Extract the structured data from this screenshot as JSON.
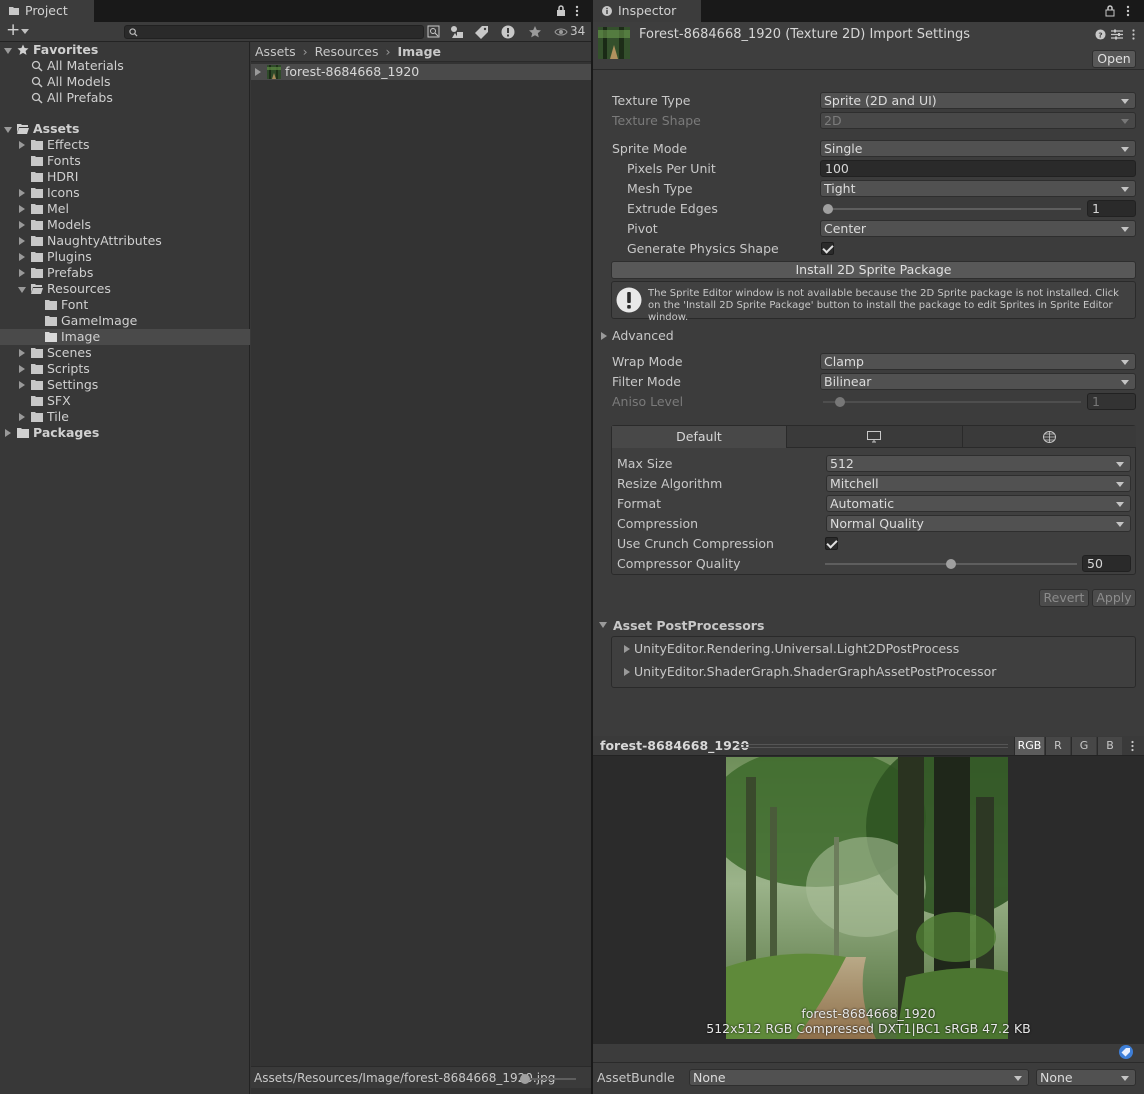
{
  "project_tab": {
    "title": "Project"
  },
  "inspector_tab": {
    "title": "Inspector"
  },
  "project_toolbar": {
    "add_label": "+",
    "search_placeholder": "",
    "hidden_count": "34"
  },
  "tree": {
    "favorites": {
      "label": "Favorites",
      "items": [
        "All Materials",
        "All Models",
        "All Prefabs"
      ]
    },
    "assets": {
      "label": "Assets",
      "folders": [
        {
          "label": "Effects"
        },
        {
          "label": "Fonts"
        },
        {
          "label": "HDRI"
        },
        {
          "label": "Icons"
        },
        {
          "label": "Mel"
        },
        {
          "label": "Models"
        },
        {
          "label": "NaughtyAttributes"
        },
        {
          "label": "Plugins"
        },
        {
          "label": "Prefabs"
        },
        {
          "label": "Resources"
        },
        {
          "label": "Font"
        },
        {
          "label": "GameImage"
        },
        {
          "label": "Image"
        },
        {
          "label": "Scenes"
        },
        {
          "label": "Scripts"
        },
        {
          "label": "Settings"
        },
        {
          "label": "SFX"
        },
        {
          "label": "Tile"
        }
      ]
    },
    "packages": {
      "label": "Packages"
    }
  },
  "breadcrumb": [
    "Assets",
    "Resources",
    "Image"
  ],
  "file_list": [
    {
      "name": "forest-8684668_1920"
    }
  ],
  "project_footer": {
    "path": "Assets/Resources/Image/forest-8684668_1920.jpg"
  },
  "inspector": {
    "title": "Forest-8684668_1920 (Texture 2D) Import Settings",
    "open_label": "Open",
    "texture_type": {
      "label": "Texture Type",
      "value": "Sprite (2D and UI)"
    },
    "texture_shape": {
      "label": "Texture Shape",
      "value": "2D"
    },
    "sprite_mode": {
      "label": "Sprite Mode",
      "value": "Single"
    },
    "pixels_per_unit": {
      "label": "Pixels Per Unit",
      "value": "100"
    },
    "mesh_type": {
      "label": "Mesh Type",
      "value": "Tight"
    },
    "extrude_edges": {
      "label": "Extrude Edges",
      "value": "1",
      "fraction": 0.0
    },
    "pivot": {
      "label": "Pivot",
      "value": "Center"
    },
    "generate_physics": {
      "label": "Generate Physics Shape",
      "checked": true
    },
    "install_button": "Install 2D Sprite Package",
    "help_text": "The Sprite Editor window is not available because the 2D Sprite package is not installed. Click on the 'Install 2D Sprite Package' button to install the package to edit Sprites in Sprite Editor window.",
    "advanced": {
      "label": "Advanced"
    },
    "wrap_mode": {
      "label": "Wrap Mode",
      "value": "Clamp"
    },
    "filter_mode": {
      "label": "Filter Mode",
      "value": "Bilinear"
    },
    "aniso_level": {
      "label": "Aniso Level",
      "value": "1",
      "fraction": 0.0
    },
    "platform_tabs": {
      "default_label": "Default"
    },
    "max_size": {
      "label": "Max Size",
      "value": "512"
    },
    "resize_algorithm": {
      "label": "Resize Algorithm",
      "value": "Mitchell"
    },
    "format": {
      "label": "Format",
      "value": "Automatic"
    },
    "compression": {
      "label": "Compression",
      "value": "Normal Quality"
    },
    "use_crunch": {
      "label": "Use Crunch Compression",
      "checked": true
    },
    "compressor_quality": {
      "label": "Compressor Quality",
      "value": "50",
      "fraction": 0.5
    },
    "revert_label": "Revert",
    "apply_label": "Apply",
    "postprocessors": {
      "label": "Asset PostProcessors",
      "items": [
        "UnityEditor.Rendering.Universal.Light2DPostProcess",
        "UnityEditor.ShaderGraph.ShaderGraphAssetPostProcessor"
      ]
    }
  },
  "preview": {
    "title": "forest-8684668_1920",
    "channels": [
      "RGB",
      "R",
      "G",
      "B"
    ],
    "caption_name": "forest-8684668_1920",
    "caption_info": "512x512  RGB Compressed DXT1|BC1 sRGB  47.2 KB"
  },
  "asset_bundle": {
    "label": "AssetBundle",
    "name_value": "None",
    "variant_value": "None"
  },
  "colors": {
    "accent": "#3e7fd8",
    "panel": "#383838",
    "field": "#2a2a2a"
  }
}
